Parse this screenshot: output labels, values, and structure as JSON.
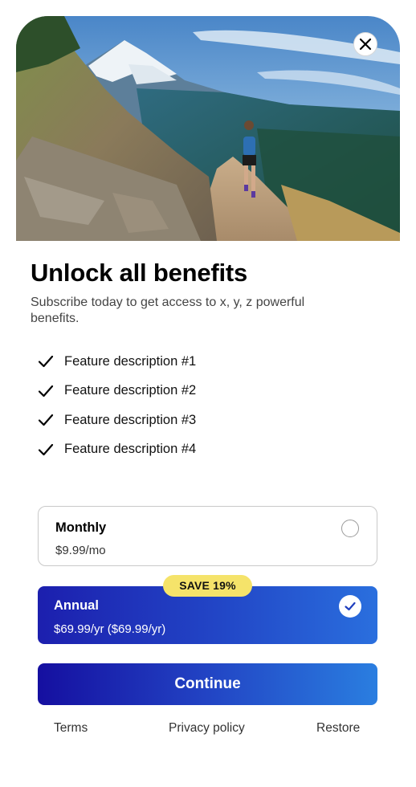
{
  "hero": {
    "image": "mountain-trail-runner-photo",
    "close_icon": "close-icon"
  },
  "title": "Unlock all benefits",
  "subtitle": "Subscribe today to get access to x, y, z powerful benefits.",
  "features": [
    "Feature description #1",
    "Feature description #2",
    "Feature description #3",
    "Feature description #4"
  ],
  "plans": {
    "monthly": {
      "name": "Monthly",
      "price": "$9.99/mo",
      "selected": false
    },
    "annual": {
      "name": "Annual",
      "price": "$69.99/yr ($69.99/yr)",
      "badge": "SAVE 19%",
      "selected": true
    }
  },
  "continue_label": "Continue",
  "footer": {
    "terms": "Terms",
    "privacy": "Privacy policy",
    "restore": "Restore"
  },
  "colors": {
    "accent_start": "#150fa0",
    "accent_end": "#2a7ee0",
    "badge": "#f5e36a"
  }
}
